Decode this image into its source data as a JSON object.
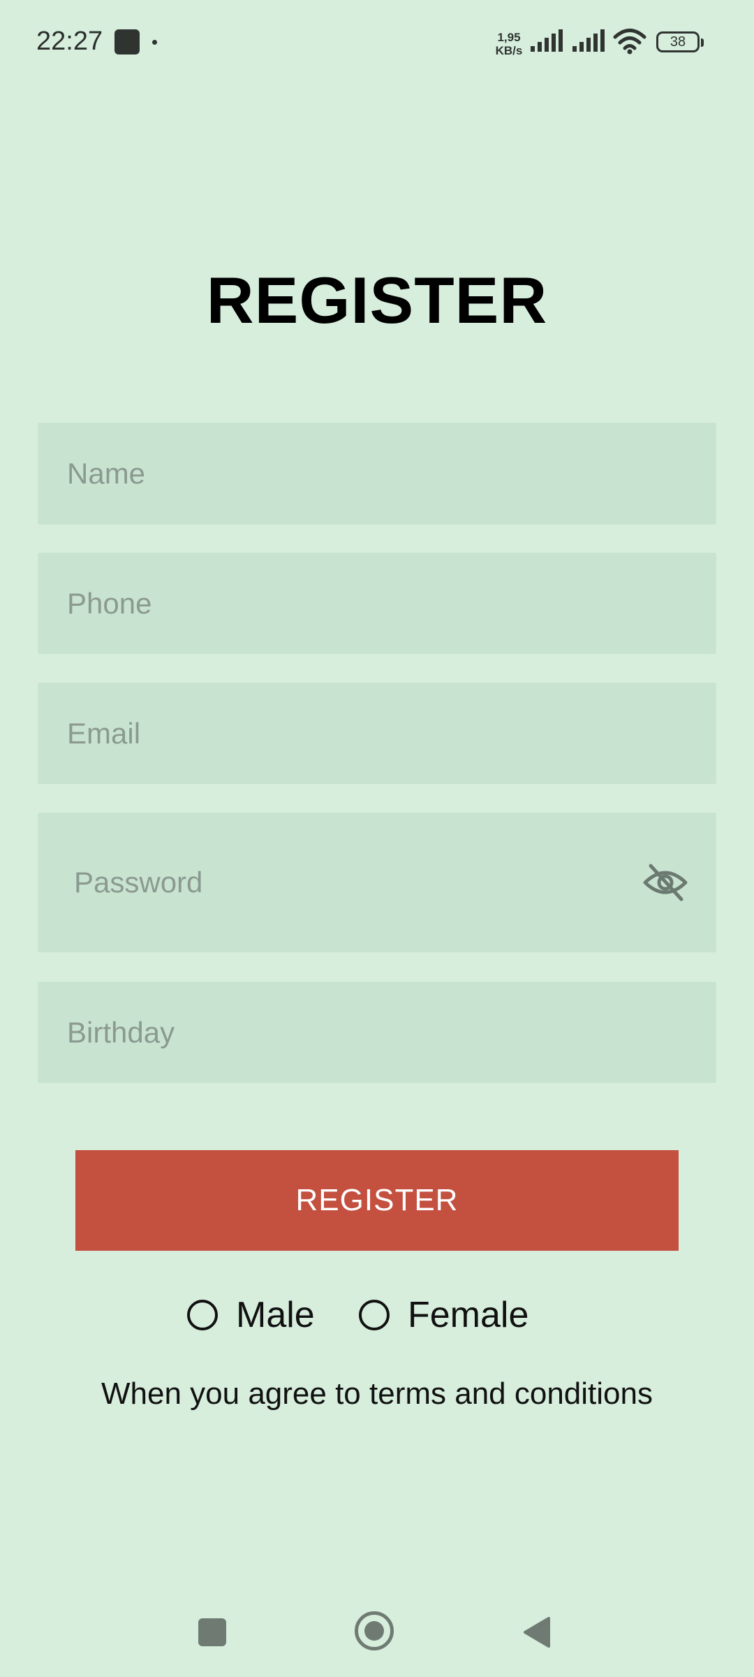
{
  "status_bar": {
    "time": "22:27",
    "net_speed_value": "1,95",
    "net_speed_unit": "KB/s",
    "battery": "38"
  },
  "page": {
    "title": "REGISTER"
  },
  "form": {
    "name_placeholder": "Name",
    "phone_placeholder": "Phone",
    "email_placeholder": "Email",
    "password_placeholder": "Password",
    "birthday_placeholder": "Birthday",
    "register_label": "REGISTER",
    "gender_options": [
      "Male",
      "Female"
    ],
    "terms_text": "When you agree to terms and conditions"
  },
  "icons": {
    "password_toggle": "eye-off-icon",
    "nav_recent": "square-icon",
    "nav_home": "circle-icon",
    "nav_back": "triangle-back-icon"
  },
  "colors": {
    "background": "#d7eedd",
    "field_background": "#c9e3d1",
    "button": "#c45040",
    "button_text": "#ffffff"
  }
}
